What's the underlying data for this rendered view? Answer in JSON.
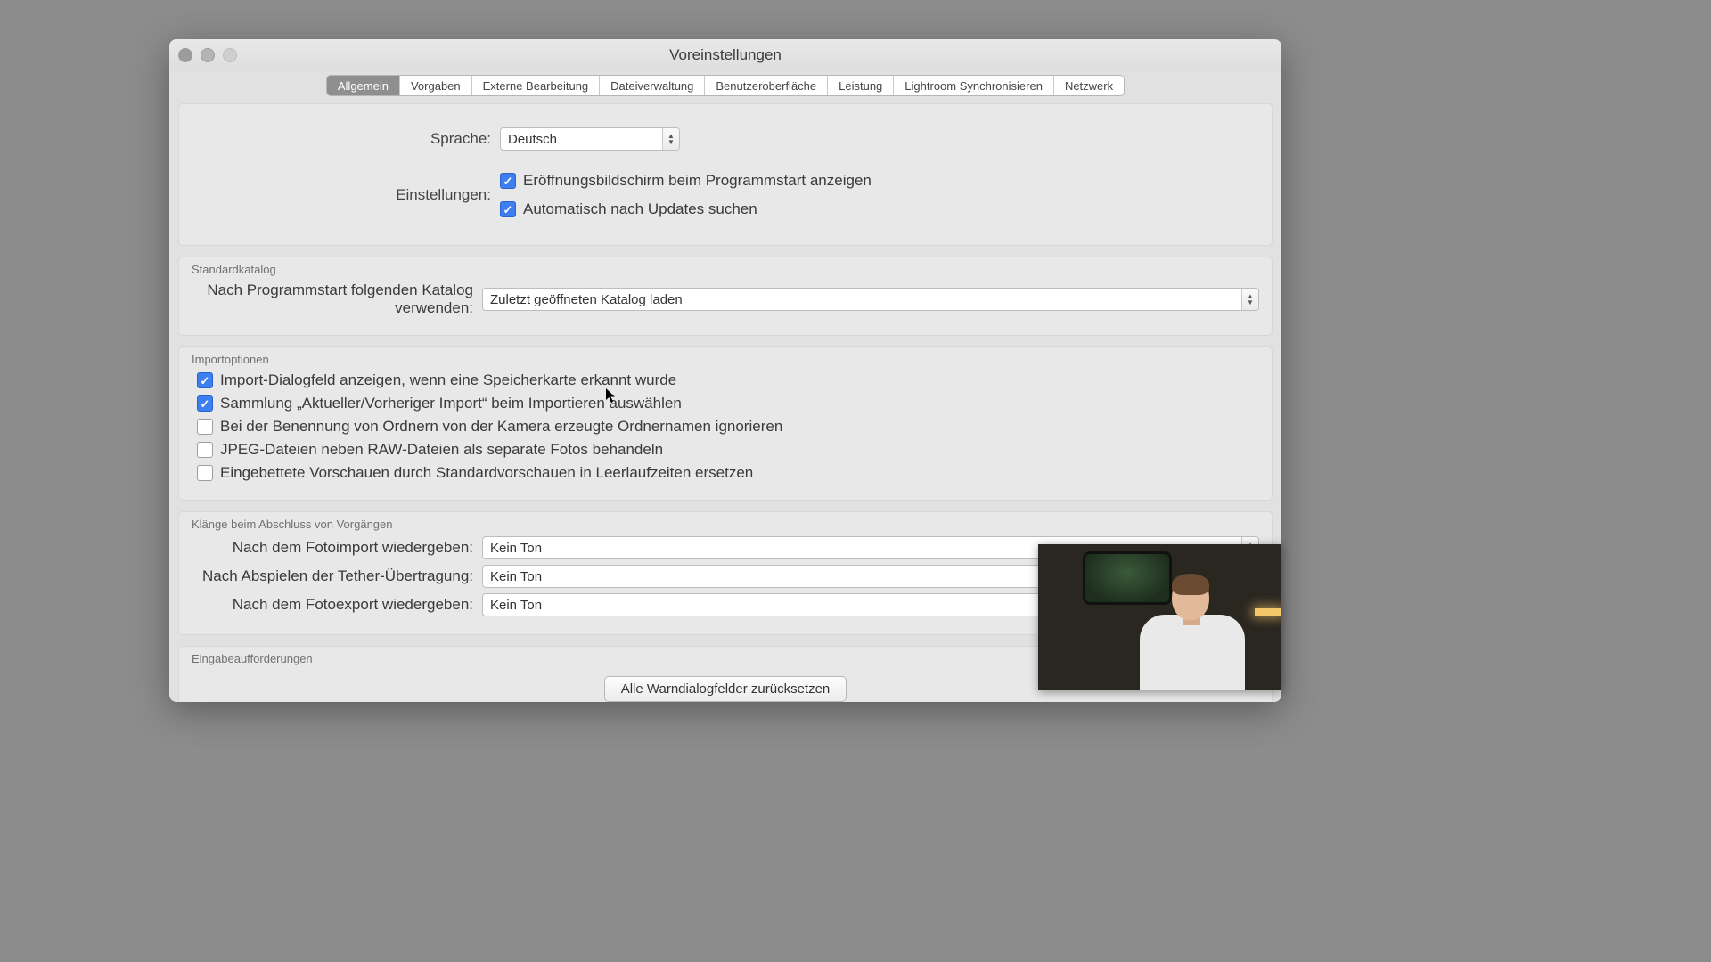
{
  "window": {
    "title": "Voreinstellungen"
  },
  "tabs": [
    {
      "label": "Allgemein",
      "active": true
    },
    {
      "label": "Vorgaben",
      "active": false
    },
    {
      "label": "Externe Bearbeitung",
      "active": false
    },
    {
      "label": "Dateiverwaltung",
      "active": false
    },
    {
      "label": "Benutzeroberfläche",
      "active": false
    },
    {
      "label": "Leistung",
      "active": false
    },
    {
      "label": "Lightroom Synchronisieren",
      "active": false
    },
    {
      "label": "Netzwerk",
      "active": false
    }
  ],
  "language": {
    "label": "Sprache:",
    "value": "Deutsch"
  },
  "settings": {
    "label": "Einstellungen:",
    "items": [
      {
        "label": "Eröffnungsbildschirm beim Programmstart anzeigen",
        "checked": true
      },
      {
        "label": "Automatisch nach Updates suchen",
        "checked": true
      }
    ]
  },
  "defaultCatalog": {
    "title": "Standardkatalog",
    "label": "Nach Programmstart folgenden Katalog verwenden:",
    "value": "Zuletzt geöffneten Katalog laden"
  },
  "importOptions": {
    "title": "Importoptionen",
    "items": [
      {
        "label": "Import-Dialogfeld anzeigen, wenn eine Speicherkarte erkannt wurde",
        "checked": true
      },
      {
        "label": "Sammlung „Aktueller/Vorheriger Import“ beim Importieren auswählen",
        "checked": true
      },
      {
        "label": "Bei der Benennung von Ordnern von der Kamera erzeugte Ordnernamen ignorieren",
        "checked": false
      },
      {
        "label": "JPEG-Dateien neben RAW-Dateien als separate Fotos behandeln",
        "checked": false
      },
      {
        "label": "Eingebettete Vorschauen durch Standardvorschauen in Leerlaufzeiten ersetzen",
        "checked": false
      }
    ]
  },
  "sounds": {
    "title": "Klänge beim Abschluss von Vorgängen",
    "noSound": "Kein Ton",
    "rows": [
      {
        "label": "Nach dem Fotoimport wiedergeben:"
      },
      {
        "label": "Nach Abspielen der Tether-Übertragung:"
      },
      {
        "label": "Nach dem Fotoexport wiedergeben:"
      }
    ]
  },
  "prompts": {
    "title": "Eingabeaufforderungen",
    "resetLabel": "Alle Warndialogfelder zurücksetzen"
  }
}
